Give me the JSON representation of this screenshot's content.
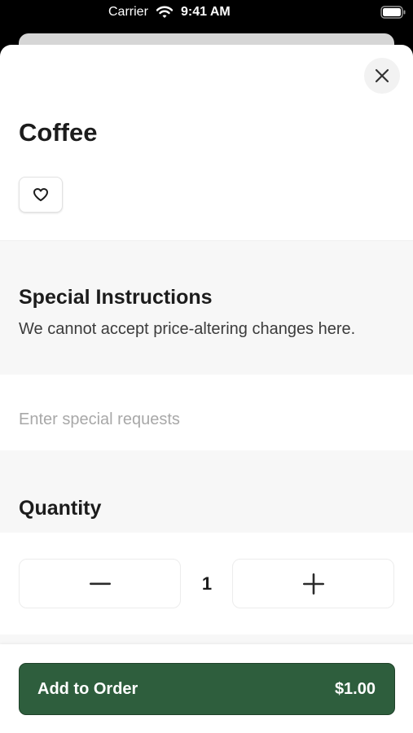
{
  "status_bar": {
    "carrier": "Carrier",
    "time": "9:41 AM"
  },
  "item": {
    "name": "Coffee"
  },
  "special_instructions": {
    "title": "Special Instructions",
    "subtitle": "We cannot accept price-altering changes here.",
    "placeholder": "Enter special requests",
    "value": ""
  },
  "quantity": {
    "title": "Quantity",
    "value": "1"
  },
  "footer": {
    "add_label": "Add to Order",
    "price": "$1.00"
  },
  "colors": {
    "accent": "#2e5e3d"
  },
  "icons": {
    "close": "close-icon",
    "favorite": "heart-icon",
    "minus": "minus-icon",
    "plus": "plus-icon",
    "wifi": "wifi-icon",
    "battery": "battery-icon"
  }
}
